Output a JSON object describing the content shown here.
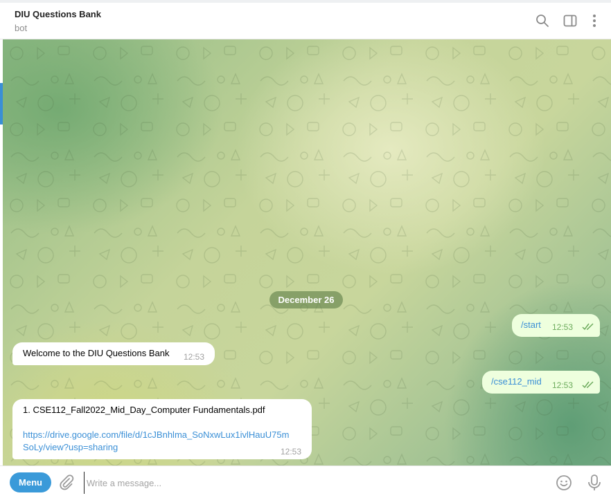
{
  "header": {
    "title": "DIU Questions Bank",
    "status": "bot",
    "icons": [
      "search-icon",
      "sidebar-toggle-icon",
      "more-vertical-icon"
    ]
  },
  "chat": {
    "date_separator": "December 26",
    "messages": [
      {
        "direction": "out",
        "text": "/start",
        "time": "12:53",
        "status": "read"
      },
      {
        "direction": "in",
        "text": "Welcome to the DIU Questions Bank",
        "time": "12:53"
      },
      {
        "direction": "out",
        "text": "/cse112_mid",
        "time": "12:53",
        "status": "read"
      },
      {
        "direction": "in",
        "text": "1. CSE112_Fall2022_Mid_Day_Computer Fundamentals.pdf",
        "link_line1": "https://drive.google.com/file/d/1cJBnhlma_SoNxwLux1ivlHauU75m",
        "link_line2": "SoLy/view?usp=sharing",
        "time": "12:53"
      }
    ]
  },
  "composer": {
    "menu_label": "Menu",
    "placeholder": "Write a message...",
    "value": "",
    "icons": [
      "paperclip-icon",
      "emoji-icon",
      "microphone-icon"
    ]
  },
  "colors": {
    "accent": "#3a9ad9",
    "outgoing_bubble": "#eeffde",
    "incoming_bubble": "#ffffff",
    "time_outgoing": "#6cab5c"
  }
}
